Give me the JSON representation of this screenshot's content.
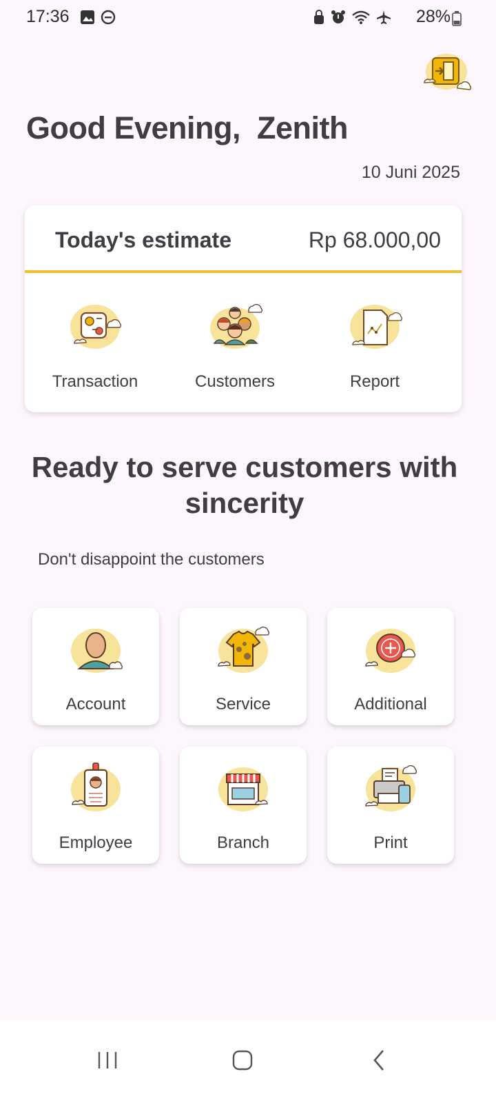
{
  "status_bar": {
    "time": "17:36",
    "battery": "28%",
    "icons": [
      "image-icon",
      "do-not-disturb-icon",
      "lock-icon",
      "alarm-icon",
      "wifi-icon",
      "airplane-icon",
      "battery-icon"
    ]
  },
  "header": {
    "greeting": "Good Evening,  Zenith",
    "date": "10 Juni 2025",
    "logout_icon": "exit-door-icon"
  },
  "estimate": {
    "label": "Today's estimate",
    "value": "Rp 68.000,00",
    "accent": "#f0c030"
  },
  "quick_actions": [
    {
      "label": "Transaction",
      "icon": "transaction-icon"
    },
    {
      "label": "Customers",
      "icon": "customers-icon"
    },
    {
      "label": "Report",
      "icon": "report-icon"
    }
  ],
  "promo": {
    "headline": "Ready to serve customers with sincerity",
    "subline": "Don't disappoint the customers"
  },
  "menu": [
    {
      "label": "Account",
      "icon": "account-icon"
    },
    {
      "label": "Service",
      "icon": "service-shirt-icon"
    },
    {
      "label": "Additional",
      "icon": "add-icon"
    },
    {
      "label": "Employee",
      "icon": "employee-badge-icon"
    },
    {
      "label": "Branch",
      "icon": "branch-store-icon"
    },
    {
      "label": "Print",
      "icon": "printer-icon"
    }
  ],
  "colors": {
    "background": "#fdf6fc",
    "blob": "#f7e39a",
    "accent": "#f0c030"
  }
}
